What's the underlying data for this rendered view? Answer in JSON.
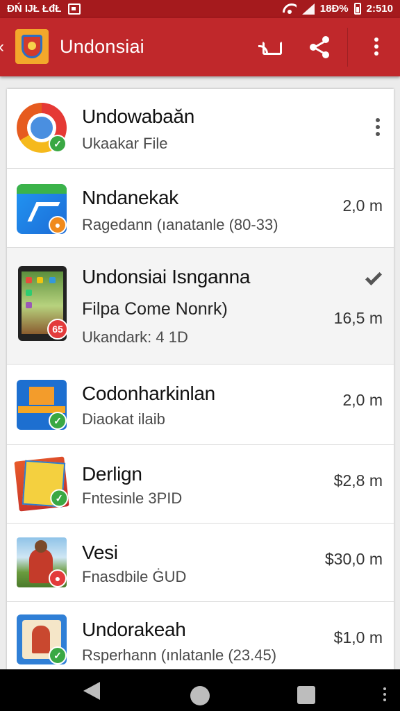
{
  "status_bar": {
    "left_text": "ĐŃ ĲŁ ŁđŁ",
    "battery": "18Ɖ%",
    "time": "2:510"
  },
  "app_bar": {
    "title": "Undonsiai"
  },
  "items": [
    {
      "title": "Undowabaăn",
      "subtitle": "Ukaakar File"
    },
    {
      "title": "Nndanekak",
      "subtitle": "Ragedann (ıanatanle (80-33)",
      "meta": "2,0 m"
    },
    {
      "title": "Undonsiai Isnganna",
      "subtitle": "Filpa Come Nonrk)",
      "subtitle2": "Ukandark: 4 1D",
      "meta": "16,5 m",
      "badge": "65"
    },
    {
      "title": "Codonharkinlan",
      "subtitle": "Diaokat ilaib",
      "meta": "2,0 m"
    },
    {
      "title": "Derlign",
      "subtitle": "Fntesinle 3PID",
      "meta": "$2,8 m"
    },
    {
      "title": "Vesi",
      "subtitle": "Fnasdbile ĠUD",
      "meta": "$30,0 m"
    },
    {
      "title": "Undorakeah",
      "subtitle": "Rsperhann (ınlatanle (23.45)",
      "meta": "$1,0 m"
    }
  ],
  "colors": {
    "status_bar": "#a51a1d",
    "app_bar": "#c0282b",
    "badge_green": "#3aa843",
    "badge_red": "#e33b3b",
    "badge_orange": "#f08a1c"
  },
  "icons": [
    "back-icon",
    "app-logo",
    "cast-icon",
    "share-icon",
    "more-vert-icon",
    "checkmark-icon",
    "nav-back-icon",
    "nav-home-icon",
    "nav-recents-icon"
  ]
}
